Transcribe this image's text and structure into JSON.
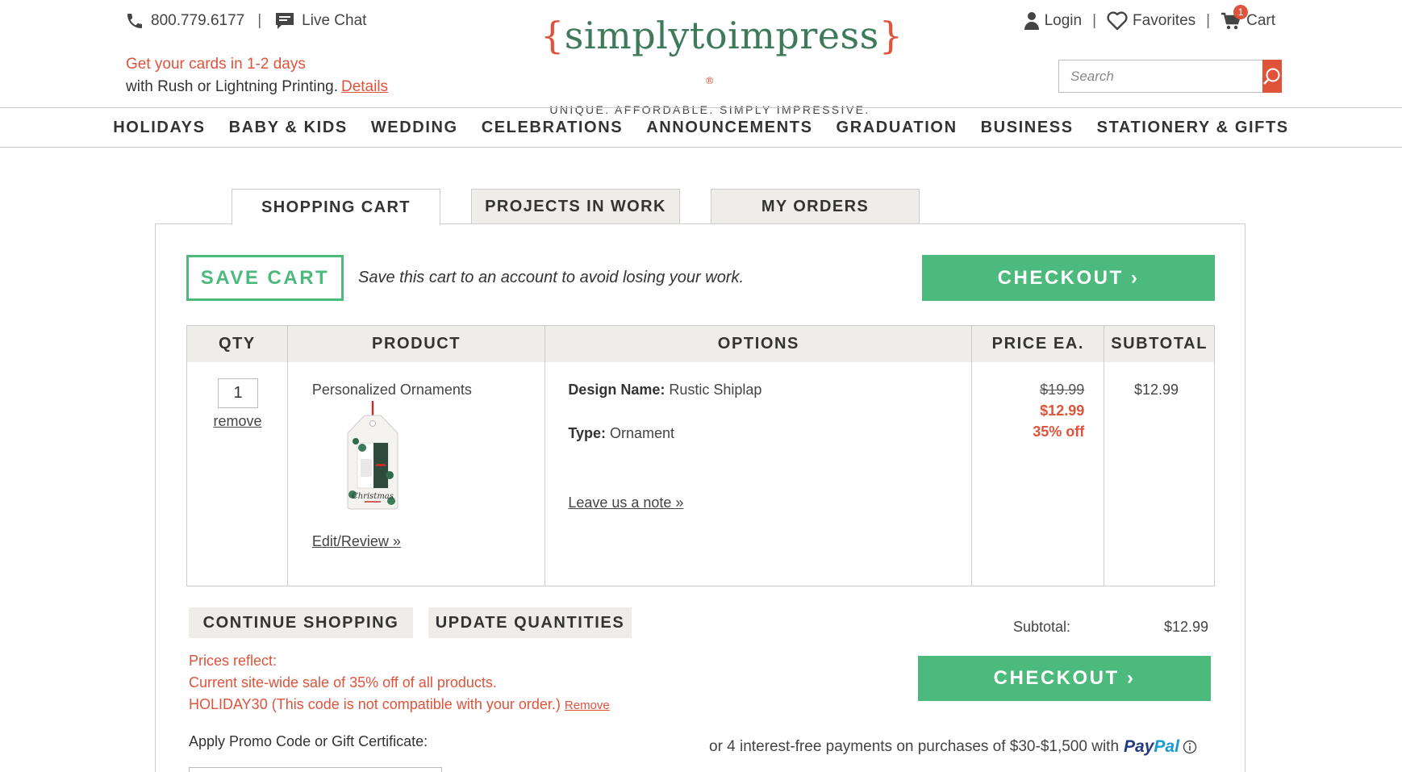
{
  "header": {
    "phone": "800.779.6177",
    "live_chat": "Live Chat",
    "promo_line1": "Get your cards in 1-2 days",
    "promo_line2": "with Rush or Lightning Printing.",
    "details_link": "Details",
    "logo_brace_open": "{",
    "logo_name": "simplytoimpress",
    "logo_brace_close": "}",
    "logo_reg": "®",
    "logo_tagline": "UNIQUE. AFFORDABLE. SIMPLY IMPRESSIVE.",
    "login": "Login",
    "favorites": "Favorites",
    "cart": "Cart",
    "cart_count": "1",
    "search_placeholder": "Search"
  },
  "nav": {
    "items": [
      "HOLIDAYS",
      "BABY & KIDS",
      "WEDDING",
      "CELEBRATIONS",
      "ANNOUNCEMENTS",
      "GRADUATION",
      "BUSINESS",
      "STATIONERY & GIFTS"
    ]
  },
  "tabs": [
    {
      "label": "SHOPPING CART",
      "active": true
    },
    {
      "label": "PROJECTS IN WORK",
      "active": false
    },
    {
      "label": "MY ORDERS",
      "active": false
    }
  ],
  "cart": {
    "save_cart_label": "SAVE CART",
    "save_message": "Save this cart to an account to avoid losing your work.",
    "checkout_label": "CHECKOUT ›",
    "columns": [
      "QTY",
      "PRODUCT",
      "OPTIONS",
      "PRICE EA.",
      "SUBTOTAL"
    ],
    "items": [
      {
        "qty": "1",
        "remove_label": "remove",
        "product_name": "Personalized Ornaments",
        "ornament_text": "Christmas",
        "edit_label": "Edit/Review »",
        "options": [
          {
            "label": "Design Name:",
            "value": "Rustic Shiplap"
          },
          {
            "label": "Type:",
            "value": "Ornament"
          }
        ],
        "note_label": "Leave us a note »",
        "price_original": "$19.99",
        "price_sale": "$12.99",
        "discount": "35% off",
        "subtotal": "$12.99"
      }
    ],
    "continue_label": "CONTINUE SHOPPING",
    "update_label": "UPDATE QUANTITIES",
    "prices_reflect": "Prices reflect:",
    "sale_note": "Current site-wide sale of 35% off of all products.",
    "code_note": "HOLIDAY30 (This code is not compatible with your order.)",
    "code_remove": "Remove",
    "promo_label": "Apply Promo Code or Gift Certificate:",
    "subtotal_label": "Subtotal:",
    "subtotal_value": "$12.99",
    "paypal_text": "or 4 interest-free payments on purchases of $30-$1,500 with",
    "paypal_pay": "Pay",
    "paypal_pal": "Pal"
  },
  "colors": {
    "accent_green": "#4cb97d",
    "accent_red": "#e0533b",
    "logo_green": "#3d7a5a",
    "tab_bg": "#efede9"
  }
}
